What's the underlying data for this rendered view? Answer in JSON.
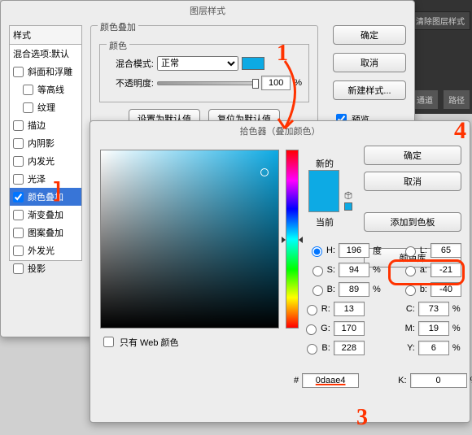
{
  "bg_panel": {
    "tab1": "通道",
    "tab2": "路径",
    "clear_btn": "清除图层样式"
  },
  "layer_dlg": {
    "title": "图层样式",
    "styles_header": "样式",
    "blend_default": "混合选项:默认",
    "items": [
      {
        "label": "斜面和浮雕",
        "checked": false,
        "indent": 0
      },
      {
        "label": "等高线",
        "checked": false,
        "indent": 1
      },
      {
        "label": "纹理",
        "checked": false,
        "indent": 1
      },
      {
        "label": "描边",
        "checked": false,
        "indent": 0
      },
      {
        "label": "内阴影",
        "checked": false,
        "indent": 0
      },
      {
        "label": "内发光",
        "checked": false,
        "indent": 0
      },
      {
        "label": "光泽",
        "checked": false,
        "indent": 0
      },
      {
        "label": "颜色叠加",
        "checked": true,
        "indent": 0,
        "selected": true
      },
      {
        "label": "渐变叠加",
        "checked": false,
        "indent": 0
      },
      {
        "label": "图案叠加",
        "checked": false,
        "indent": 0
      },
      {
        "label": "外发光",
        "checked": false,
        "indent": 0
      },
      {
        "label": "投影",
        "checked": false,
        "indent": 0
      }
    ],
    "group_title": "颜色叠加",
    "inner_title": "颜色",
    "blend_mode_lbl": "混合模式:",
    "blend_mode_val": "正常",
    "opacity_lbl": "不透明度:",
    "opacity_val": "100",
    "opacity_unit": "%",
    "set_default_btn": "设置为默认值",
    "reset_default_btn": "复位为默认值",
    "ok": "确定",
    "cancel": "取消",
    "new_style": "新建样式...",
    "preview": "预览",
    "swatch_color": "#0daae4"
  },
  "picker": {
    "title": "拾色器（叠加颜色）",
    "new_lbl": "新的",
    "current_lbl": "当前",
    "new_color": "#0daae4",
    "current_color": "#0daae4",
    "ok": "确定",
    "cancel": "取消",
    "add_swatch": "添加到色板",
    "color_lib": "颜色库",
    "H": {
      "v": "196",
      "u": "度"
    },
    "S": {
      "v": "94",
      "u": "%"
    },
    "Bri": {
      "v": "89",
      "u": "%"
    },
    "L": {
      "v": "65"
    },
    "a": {
      "v": "-21"
    },
    "b": {
      "v": "-40"
    },
    "R": {
      "v": "13"
    },
    "G": {
      "v": "170"
    },
    "Bl": {
      "v": "228"
    },
    "C": {
      "v": "73",
      "u": "%"
    },
    "M": {
      "v": "19",
      "u": "%"
    },
    "Y": {
      "v": "6",
      "u": "%"
    },
    "K": {
      "v": "0",
      "u": "%"
    },
    "hex_prefix": "#",
    "hex": "0daae4",
    "web_only": "只有 Web 颜色",
    "labels": {
      "H": "H:",
      "S": "S:",
      "B": "B:",
      "R": "R:",
      "G": "G:",
      "Bl": "B:",
      "L": "L:",
      "a": "a:",
      "b": "b:",
      "C": "C:",
      "M": "M:",
      "Y": "Y:",
      "K": "K:"
    }
  },
  "anno": {
    "n1": "1",
    "n3": "3",
    "n4": "4"
  }
}
